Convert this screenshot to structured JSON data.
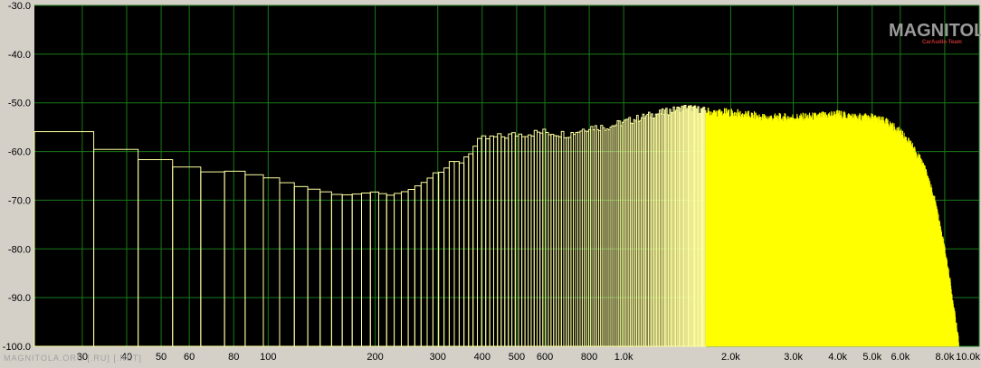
{
  "colors": {
    "background": "#000000",
    "grid": "#1a7a1a",
    "bars_outline": "#ffffa0",
    "bars_fill": "#ffff00",
    "frame": "#d4d0c8",
    "logo_red": "#c03030"
  },
  "logo": {
    "main": "MAGNITOLA",
    "sub": "CarAudio Team"
  },
  "watermark": "MAGNITOLA.ORG [.RU] [.NET]",
  "chart_data": {
    "type": "bar",
    "x_scale": "log",
    "xlim": [
      22,
      10000
    ],
    "ylim": [
      -100,
      -30
    ],
    "grid": true,
    "title": "",
    "xlabel": "",
    "ylabel": "",
    "y_ticks": [
      {
        "value": -30,
        "label": "-30.0"
      },
      {
        "value": -40,
        "label": "-40.0"
      },
      {
        "value": -50,
        "label": "-50.0"
      },
      {
        "value": -60,
        "label": "-60.0"
      },
      {
        "value": -70,
        "label": "-70.0"
      },
      {
        "value": -80,
        "label": "-80.0"
      },
      {
        "value": -90,
        "label": "-90.0"
      },
      {
        "value": -100,
        "label": "-100.0"
      }
    ],
    "x_ticks": [
      {
        "value": 30,
        "label": "30"
      },
      {
        "value": 40,
        "label": "40"
      },
      {
        "value": 50,
        "label": "50"
      },
      {
        "value": 60,
        "label": "60"
      },
      {
        "value": 80,
        "label": "80"
      },
      {
        "value": 100,
        "label": "100"
      },
      {
        "value": 200,
        "label": "200"
      },
      {
        "value": 300,
        "label": "300"
      },
      {
        "value": 400,
        "label": "400"
      },
      {
        "value": 500,
        "label": "500"
      },
      {
        "value": 600,
        "label": "600"
      },
      {
        "value": 800,
        "label": "800"
      },
      {
        "value": 1000,
        "label": "1.0k"
      },
      {
        "value": 2000,
        "label": "2.0k"
      },
      {
        "value": 3000,
        "label": "3.0k"
      },
      {
        "value": 4000,
        "label": "4.0k"
      },
      {
        "value": 5000,
        "label": "5.0k"
      },
      {
        "value": 6000,
        "label": "6.0k"
      },
      {
        "value": 8000,
        "label": "8.0k"
      },
      {
        "value": 10000,
        "label": "10.0k"
      }
    ],
    "bin_width_hz": 10.77,
    "spectrum": {
      "name": "",
      "anchors_hz_db": [
        [
          22,
          -52.2
        ],
        [
          30,
          -58.2
        ],
        [
          40,
          -60
        ],
        [
          50,
          -62
        ],
        [
          60,
          -63.3
        ],
        [
          70,
          -64.2
        ],
        [
          80,
          -64
        ],
        [
          90,
          -64.7
        ],
        [
          100,
          -65.2
        ],
        [
          120,
          -67
        ],
        [
          140,
          -68
        ],
        [
          160,
          -69
        ],
        [
          180,
          -68.7
        ],
        [
          200,
          -68.3
        ],
        [
          220,
          -69
        ],
        [
          250,
          -68
        ],
        [
          280,
          -66
        ],
        [
          300,
          -64
        ],
        [
          350,
          -62
        ],
        [
          400,
          -57.5
        ],
        [
          450,
          -57
        ],
        [
          500,
          -56.5
        ],
        [
          600,
          -56
        ],
        [
          700,
          -56.5
        ],
        [
          800,
          -55
        ],
        [
          900,
          -55
        ],
        [
          1000,
          -54
        ],
        [
          1200,
          -52.5
        ],
        [
          1500,
          -51
        ],
        [
          1800,
          -52
        ],
        [
          2000,
          -52
        ],
        [
          2500,
          -53
        ],
        [
          3000,
          -53
        ],
        [
          3500,
          -52.8
        ],
        [
          4000,
          -52.3
        ],
        [
          4500,
          -53
        ],
        [
          5000,
          -53
        ],
        [
          5500,
          -54
        ],
        [
          6000,
          -56
        ],
        [
          6500,
          -59
        ],
        [
          7000,
          -63
        ],
        [
          7500,
          -70
        ],
        [
          8000,
          -80
        ],
        [
          8300,
          -87
        ],
        [
          8600,
          -95
        ],
        [
          8800,
          -100
        ]
      ]
    }
  }
}
